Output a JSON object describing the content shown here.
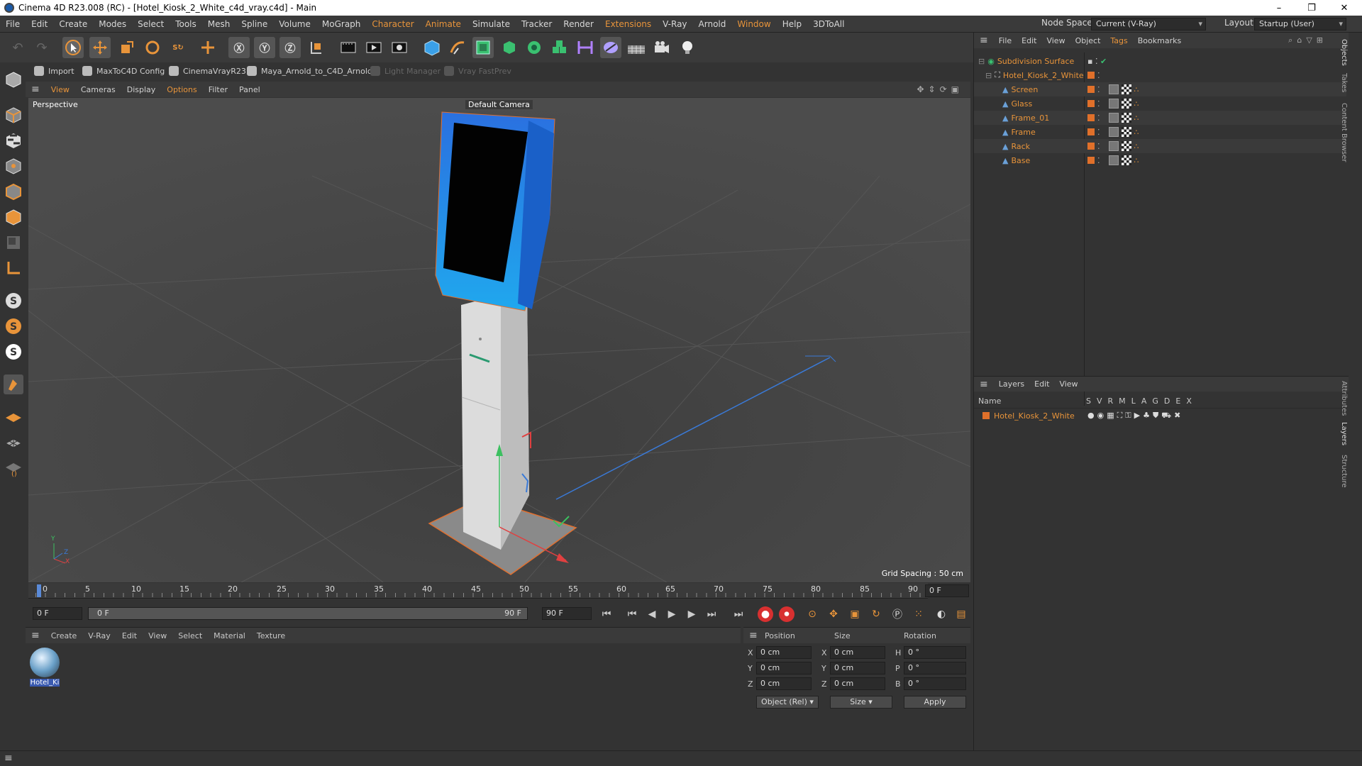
{
  "window": {
    "title": "Cinema 4D R23.008 (RC) - [Hotel_Kiosk_2_White_c4d_vray.c4d] - Main",
    "controls": [
      "–",
      "❐",
      "✕"
    ]
  },
  "menubar": {
    "items": [
      "File",
      "Edit",
      "Create",
      "Modes",
      "Select",
      "Tools",
      "Mesh",
      "Spline",
      "Volume",
      "MoGraph",
      "Character",
      "Animate",
      "Simulate",
      "Tracker",
      "Render",
      "Extensions",
      "V-Ray",
      "Arnold",
      "Window",
      "Help",
      "3DToAll"
    ],
    "node_space_label": "Node Space:",
    "node_space_value": "Current (V-Ray)",
    "layout_label": "Layout:",
    "layout_value": "Startup (User)"
  },
  "plugins": {
    "items": [
      "Import",
      "MaxToC4D Config",
      "CinemaVrayR23",
      "Maya_Arnold_to_C4D_Arnold",
      "Light Manager",
      "Vray FastPrev"
    ]
  },
  "viewport": {
    "menu": [
      "View",
      "Cameras",
      "Display",
      "Options",
      "Filter",
      "Panel"
    ],
    "label": "Perspective",
    "camera": "Default Camera",
    "grid_spacing": "Grid Spacing : 50 cm",
    "axis_y": "Y",
    "axis_z": "Z",
    "axis_x": "X"
  },
  "objects": {
    "menu": [
      "File",
      "Edit",
      "View",
      "Object",
      "Tags",
      "Bookmarks"
    ],
    "root": "Subdivision Surface",
    "group": "Hotel_Kiosk_2_White",
    "children": [
      "Screen",
      "Glass",
      "Frame_01",
      "Frame",
      "Rack",
      "Base"
    ]
  },
  "layers": {
    "menu": [
      "Layers",
      "Edit",
      "View"
    ],
    "col_name": "Name",
    "cols": [
      "S",
      "V",
      "R",
      "M",
      "L",
      "A",
      "G",
      "D",
      "E",
      "X"
    ],
    "row": "Hotel_Kiosk_2_White"
  },
  "side_tabs": [
    "Objects",
    "Takes",
    "Content Browser",
    "Attributes",
    "Layers",
    "Structure"
  ],
  "timeline": {
    "ticks": [
      "0",
      "5",
      "10",
      "15",
      "20",
      "25",
      "30",
      "35",
      "40",
      "45",
      "50",
      "55",
      "60",
      "65",
      "70",
      "75",
      "80",
      "85",
      "90"
    ],
    "current_frame": "0 F",
    "start": "0 F",
    "range_start": "0 F",
    "range_end": "90 F",
    "end": "90 F"
  },
  "material_manager": {
    "menu": [
      "Create",
      "V-Ray",
      "Edit",
      "View",
      "Select",
      "Material",
      "Texture"
    ],
    "material_name": "Hotel_Ki"
  },
  "coordinates": {
    "headers": [
      "Position",
      "Size",
      "Rotation"
    ],
    "rows": [
      {
        "axis": "X",
        "pos": "0 cm",
        "saxis": "X",
        "size": "0 cm",
        "raxis": "H",
        "rot": "0 °"
      },
      {
        "axis": "Y",
        "pos": "0 cm",
        "saxis": "Y",
        "size": "0 cm",
        "raxis": "P",
        "rot": "0 °"
      },
      {
        "axis": "Z",
        "pos": "0 cm",
        "saxis": "Z",
        "size": "0 cm",
        "raxis": "B",
        "rot": "0 °"
      }
    ],
    "mode": "Object (Rel)",
    "size_mode": "Size",
    "apply": "Apply"
  },
  "colors": {
    "accent": "#e8943a",
    "kiosk_blue": "#1a9fe8",
    "viewport_bg": "#4a4a4a"
  }
}
